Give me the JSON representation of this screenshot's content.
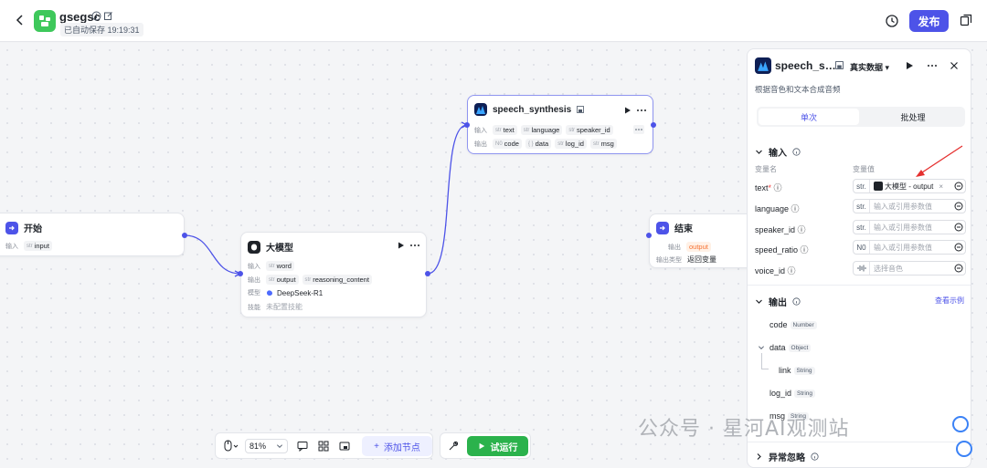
{
  "header": {
    "app_name": "gsegsc",
    "autosave": "已自动保存 19:19:31",
    "publish_label": "发布"
  },
  "nodes": {
    "start": {
      "title": "开始",
      "input_label": "输入",
      "input_var": "input",
      "input_type": "str"
    },
    "llm": {
      "title": "大模型",
      "input_label": "输入",
      "input_var": "word",
      "input_type": "str",
      "output_label": "输出",
      "out1": "output",
      "out2": "reasoning_content",
      "out_type": "str",
      "model_label": "模型",
      "model": "DeepSeek-R1",
      "skill_label": "技能",
      "skill": "未配置技能"
    },
    "speech": {
      "title": "speech_synthesis",
      "input_label": "输入",
      "in1": "text",
      "in2": "language",
      "in3": "speaker_id",
      "in_type": "str",
      "output_label": "输出",
      "out1": "code",
      "out2": "data",
      "out3": "log_id",
      "out4": "msg",
      "out1_type": "N0",
      "out2_type": "{ }",
      "out3_type": "str",
      "out4_type": "str"
    },
    "end": {
      "title": "结束",
      "output_label": "输出",
      "output_var": "output",
      "outtype_label": "输出类型",
      "outtype": "返回变量"
    }
  },
  "panel": {
    "title": "speech_s…",
    "mode": "真实数据",
    "description": "根据音色和文本合成音频",
    "tab_single": "单次",
    "tab_batch": "批处理",
    "input_section": "输入",
    "col_name": "变量名",
    "col_value": "变量值",
    "fields": [
      {
        "name": "text",
        "type": "str.",
        "value": "大模型 - output",
        "required": "*"
      },
      {
        "name": "language",
        "type": "str.",
        "value": "输入或引用参数值"
      },
      {
        "name": "speaker_id",
        "type": "str.",
        "value": "输入或引用参数值"
      },
      {
        "name": "speed_ratio",
        "type": "N0",
        "value": "输入或引用参数值"
      },
      {
        "name": "voice_id",
        "type": "",
        "value": "选择音色"
      }
    ],
    "output_section": "输出",
    "view_example": "查看示例",
    "outputs": [
      {
        "name": "code",
        "type": "Number"
      },
      {
        "name": "data",
        "type": "Object"
      },
      {
        "name": "link",
        "type": "String"
      },
      {
        "name": "log_id",
        "type": "String"
      },
      {
        "name": "msg",
        "type": "String"
      }
    ],
    "exception_section": "异常忽略"
  },
  "toolbar": {
    "zoom": "81%",
    "add_node": "添加节点",
    "test_run": "试运行"
  },
  "watermark": "公众号 · 星河AI观测站",
  "colors": {
    "accent": "#4d53e8",
    "run": "#2bb24c",
    "start_icon": "#4d53e8",
    "end_icon": "#4d53e8",
    "app_logo": "#3ec85b"
  }
}
